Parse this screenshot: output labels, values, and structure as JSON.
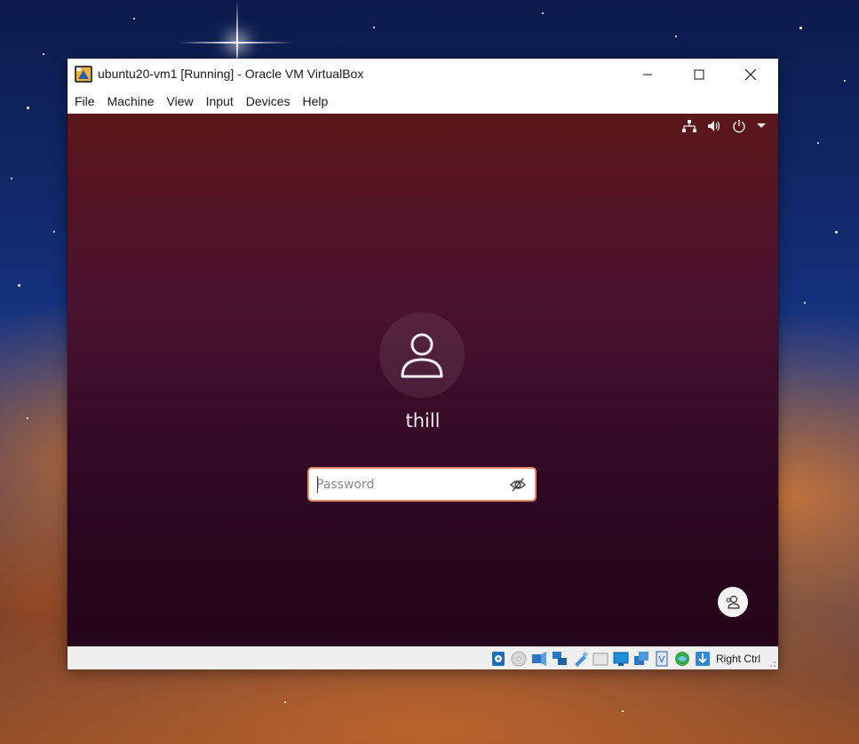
{
  "window": {
    "title": "ubuntu20-vm1 [Running] - Oracle VM VirtualBox",
    "app_icon": "virtualbox-icon"
  },
  "menubar": {
    "items": [
      "File",
      "Machine",
      "View",
      "Input",
      "Devices",
      "Help"
    ]
  },
  "guest": {
    "top_panel_icons": [
      "network-icon",
      "volume-icon",
      "power-icon",
      "dropdown-arrow-icon"
    ],
    "username": "thill",
    "password_placeholder": "Password",
    "password_value": "",
    "reveal_icon": "eye-slash-icon",
    "switch_user_icon": "user-switch-icon"
  },
  "statusbar": {
    "icons": [
      "hard-disk-icon",
      "optical-drive-icon",
      "audio-icon",
      "network-adapters-icon",
      "usb-icon",
      "shared-folders-icon",
      "display-icon",
      "video-capture-icon",
      "cpu-virtualization-icon",
      "mouse-integration-icon",
      "keyboard-capture-icon"
    ],
    "host_key": "Right Ctrl"
  },
  "colors": {
    "password_border": "#e9856a",
    "guest_bg_top": "#5b1619",
    "guest_bg_bottom": "#24041a"
  }
}
